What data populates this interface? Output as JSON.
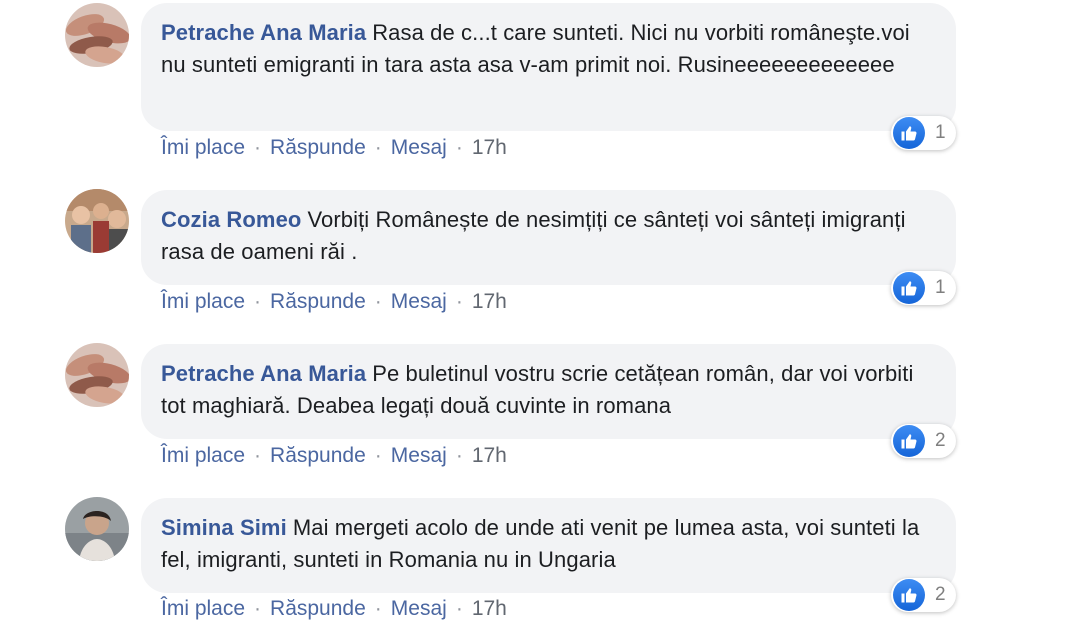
{
  "comments": [
    {
      "author": "Petrache Ana Maria",
      "text": "Rasa de c...t care sunteti. Nici nu vorbiti româneşte.voi nu sunteti emigranti in tara asta asa v-am primit noi. Rusineeeeeeeeeeeee",
      "actions": {
        "like": "Îmi place",
        "reply": "Răspunde",
        "message": "Mesaj",
        "time": "17h"
      },
      "reaction_count": "1",
      "avatar_icon": "hands-avatar"
    },
    {
      "author": "Cozia Romeo",
      "text": "Vorbiți Românește de nesimțiți ce sânteți voi sânteți imigranți rasa de oameni răi .",
      "actions": {
        "like": "Îmi place",
        "reply": "Răspunde",
        "message": "Mesaj",
        "time": "17h"
      },
      "reaction_count": "1",
      "avatar_icon": "group-photo-avatar"
    },
    {
      "author": "Petrache Ana Maria",
      "text": "Pe buletinul vostru scrie cetățean român, dar voi vorbiti tot maghiară. Deabea legați două cuvinte in romana",
      "actions": {
        "like": "Îmi place",
        "reply": "Răspunde",
        "message": "Mesaj",
        "time": "17h"
      },
      "reaction_count": "2",
      "avatar_icon": "hands-avatar"
    },
    {
      "author": "Simina Simi",
      "text": "Mai mergeti acolo de unde ati venit pe lumea asta, voi sunteti la fel, imigranti, sunteti in Romania nu in Ungaria",
      "actions": {
        "like": "Îmi place",
        "reply": "Răspunde",
        "message": "Mesaj",
        "time": "17h"
      },
      "reaction_count": "2",
      "avatar_icon": "person-avatar"
    }
  ],
  "colors": {
    "author": "#385898",
    "link": "#4b67a1",
    "bubble": "#f2f3f5",
    "like": "#1877f2"
  }
}
